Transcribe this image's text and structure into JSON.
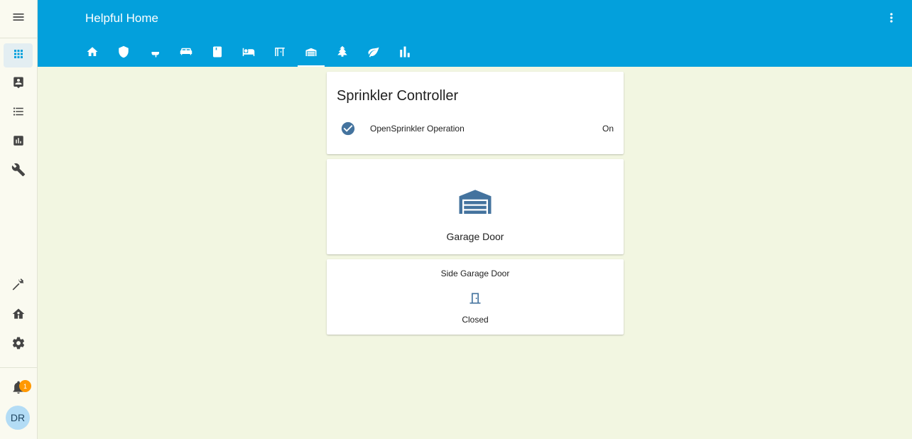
{
  "app": {
    "title": "Helpful Home"
  },
  "sidebar": {
    "items": [
      {
        "name": "menu-icon"
      },
      {
        "name": "overview-icon",
        "active": true
      },
      {
        "name": "map-icon"
      },
      {
        "name": "logbook-icon"
      },
      {
        "name": "history-icon"
      },
      {
        "name": "wrench-icon"
      },
      {
        "name": "hammer-icon"
      },
      {
        "name": "hacs-icon"
      },
      {
        "name": "gear-icon"
      }
    ],
    "notifications_count": "1",
    "user_initials": "DR"
  },
  "tabs": [
    {
      "name": "home-icon"
    },
    {
      "name": "shield-icon"
    },
    {
      "name": "bathtub-icon"
    },
    {
      "name": "sofa-icon"
    },
    {
      "name": "book-icon"
    },
    {
      "name": "bed-icon"
    },
    {
      "name": "door-open-icon"
    },
    {
      "name": "garage-icon",
      "active": true
    },
    {
      "name": "pine-tree-icon"
    },
    {
      "name": "leaf-icon"
    },
    {
      "name": "chart-icon"
    }
  ],
  "cards": {
    "sprinkler": {
      "title": "Sprinkler Controller",
      "entity": {
        "name": "OpenSprinkler Operation",
        "state": "On",
        "icon": "check-circle-icon"
      }
    },
    "garage": {
      "name": "Garage Door",
      "icon": "garage-icon"
    },
    "side_garage": {
      "title": "Side Garage Door",
      "state": "Closed",
      "icon": "door-closed-icon"
    }
  },
  "colors": {
    "header": "#03a0dc",
    "background": "#f2f6e1",
    "icon": "#44739e",
    "badge": "#ff9800"
  }
}
